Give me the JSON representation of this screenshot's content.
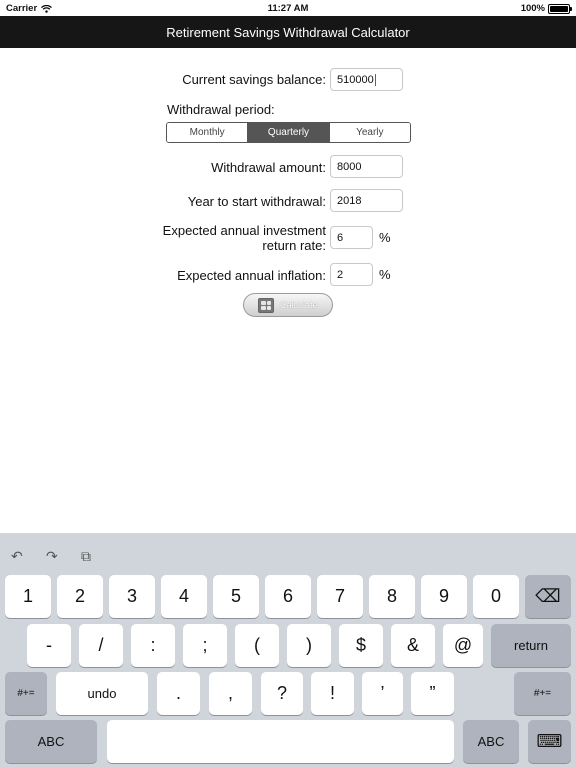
{
  "status_bar": {
    "carrier": "Carrier",
    "time": "11:27 AM",
    "battery": "100%"
  },
  "title": "Retirement Savings Withdrawal Calculator",
  "form": {
    "balance_label": "Current savings balance:",
    "balance_value": "510000",
    "period_label": "Withdrawal period:",
    "period_options": [
      "Monthly",
      "Quarterly",
      "Yearly"
    ],
    "period_selected": "Quarterly",
    "amount_label": "Withdrawal amount:",
    "amount_value": "8000",
    "start_year_label": "Year to start withdrawal:",
    "start_year_value": "2018",
    "return_rate_label_line1": "Expected annual investment",
    "return_rate_label_line2": "return rate:",
    "return_rate_value": "6",
    "inflation_label": "Expected annual inflation:",
    "inflation_value": "2",
    "percent_symbol": "%",
    "calculate_label": "Calculate"
  },
  "keyboard": {
    "shortcuts": [
      "↶",
      "↷",
      "⧉"
    ],
    "row1": [
      "1",
      "2",
      "3",
      "4",
      "5",
      "6",
      "7",
      "8",
      "9",
      "0"
    ],
    "delete_symbol": "⌫",
    "row2": [
      "-",
      "/",
      ":",
      ";",
      "(",
      ")",
      "$",
      "&",
      "@"
    ],
    "return_label": "return",
    "symbols_label": "#+=",
    "undo_label": "undo",
    "row3": [
      ".",
      ",",
      "?",
      "!",
      "’",
      "”"
    ],
    "abc_label": "ABC",
    "hide_keyboard_symbol": "⌨"
  },
  "colors": {
    "title_bar": "#161616",
    "segment_selected": "#555555",
    "keyboard_bg": "#d0d4db",
    "caret": "#1a6bf0"
  }
}
